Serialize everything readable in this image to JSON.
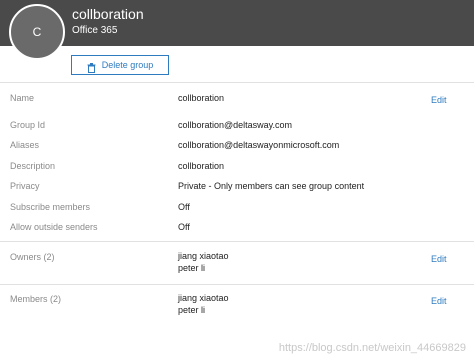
{
  "header": {
    "avatar_letter": "C",
    "title": "collboration",
    "subtitle": "Office 365"
  },
  "actions": {
    "delete_label": "Delete group"
  },
  "fields": {
    "name": {
      "label": "Name",
      "value": "collboration",
      "edit": "Edit"
    },
    "group_id": {
      "label": "Group Id",
      "value": "collboration@deltasway.com"
    },
    "aliases": {
      "label": "Aliases",
      "value": "collboration@deltaswayonmicrosoft.com"
    },
    "description": {
      "label": "Description",
      "value": "collboration"
    },
    "privacy": {
      "label": "Privacy",
      "value": "Private - Only members can see group content"
    },
    "subscribe_members": {
      "label": "Subscribe members",
      "value": "Off"
    },
    "allow_outside_senders": {
      "label": "Allow outside senders",
      "value": "Off"
    }
  },
  "owners": {
    "label": "Owners (2)",
    "members": [
      "jiang xiaotao",
      "peter li"
    ],
    "edit": "Edit"
  },
  "members": {
    "label": "Members (2)",
    "members": [
      "jiang xiaotao",
      "peter li"
    ],
    "edit": "Edit"
  },
  "watermark": "https://blog.csdn.net/weixin_44669829"
}
